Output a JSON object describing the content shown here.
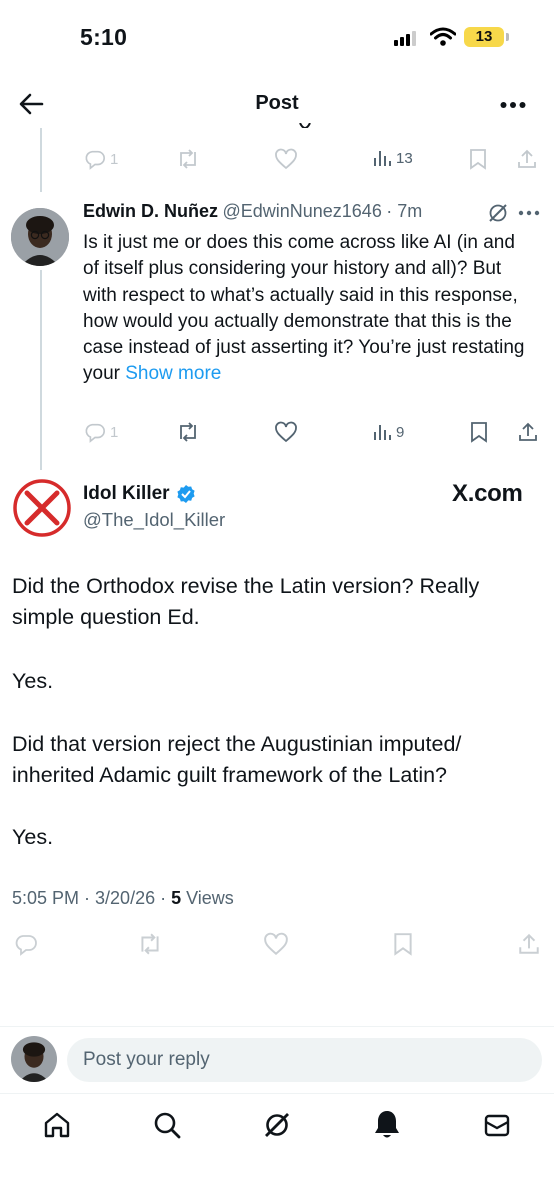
{
  "status_bar": {
    "time": "5:10",
    "battery": "13"
  },
  "header": {
    "title": "Post"
  },
  "prev_reply_actions": {
    "replies": "1",
    "views": "13"
  },
  "reply": {
    "name": "Edwin D. Nuñez",
    "handle": "@EdwinNunez1646",
    "time": "· 7m",
    "text": "Is it just me or does this come across like AI (in and of itself plus considering your history and all)? But with respect to what’s actually said in this response, how would you actually demonstrate that this is the case instead of just asserting it? You’re just restating your ",
    "show_more": "Show more",
    "replies": "1",
    "views": "9"
  },
  "post": {
    "name": "Idol Killer",
    "handle": "@The_Idol_Killer",
    "watermark": "X.com",
    "paragraphs": [
      "Did the Orthodox revise the Latin version? Really simple question Ed.",
      "Yes.",
      "Did that version reject the Augustinian imputed/ inherited Adamic guilt framework of the Latin?",
      "Yes."
    ],
    "timestamp": "5:05 PM · 3/20/26 · ",
    "views_count": "5",
    "views_label": " Views"
  },
  "composer": {
    "placeholder": "Post your reply"
  },
  "colors": {
    "accent": "#1d9bf0",
    "muted": "#536471",
    "divider": "#eff3f4"
  }
}
